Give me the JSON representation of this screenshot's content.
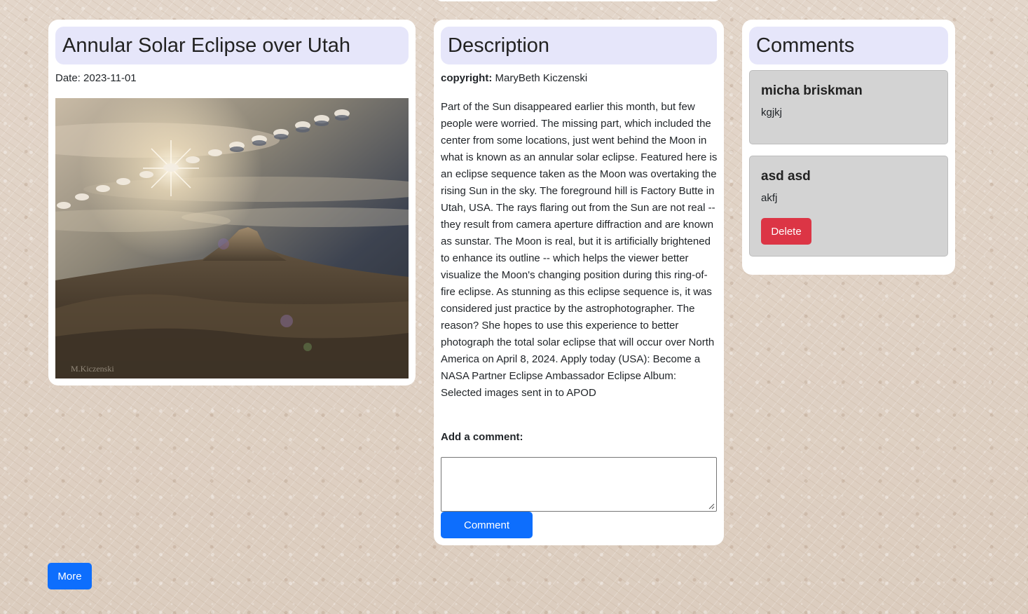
{
  "apod": {
    "title": "Annular Solar Eclipse over Utah",
    "date_line": "Date: 2023-11-01",
    "image_alt": "Annular solar eclipse sequence over Factory Butte, Utah",
    "watermark": "M.Kiczenski"
  },
  "description": {
    "heading": "Description",
    "copyright_label": "copyright:",
    "copyright_value": "MaryBeth Kiczenski",
    "explanation": "Part of the Sun disappeared earlier this month, but few people were worried. The missing part, which included the center from some locations, just went behind the Moon in what is known as an annular solar eclipse. Featured here is an eclipse sequence taken as the Moon was overtaking the rising Sun in the sky. The foreground hill is Factory Butte in Utah, USA. The rays flaring out from the Sun are not real -- they result from camera aperture diffraction and are known as sunstar. The Moon is real, but it is artificially brightened to enhance its outline -- which helps the viewer better visualize the Moon's changing position during this ring-of-fire eclipse. As stunning as this eclipse sequence is, it was considered just practice by the astrophotographer. The reason? She hopes to use this experience to better photograph the total solar eclipse that will occur over North America on April 8, 2024. Apply today (USA): Become a NASA Partner Eclipse Ambassador Eclipse Album: Selected images sent in to APOD",
    "add_comment_label": "Add a comment:",
    "comment_placeholder": "",
    "comment_value": "",
    "comment_button": "Comment"
  },
  "comments": {
    "heading": "Comments",
    "items": [
      {
        "author": "micha briskman",
        "text": "kgjkj"
      },
      {
        "author": "asd asd",
        "text": "akfj",
        "delete_label": "Delete"
      }
    ]
  },
  "footer": {
    "more_button": "More"
  },
  "colors": {
    "title_bg": "#e6e6fa",
    "primary": "#0d6efd",
    "danger": "#dc3545",
    "comment_bg": "#d3d3d3",
    "page_bg": "#e0d3c6"
  }
}
